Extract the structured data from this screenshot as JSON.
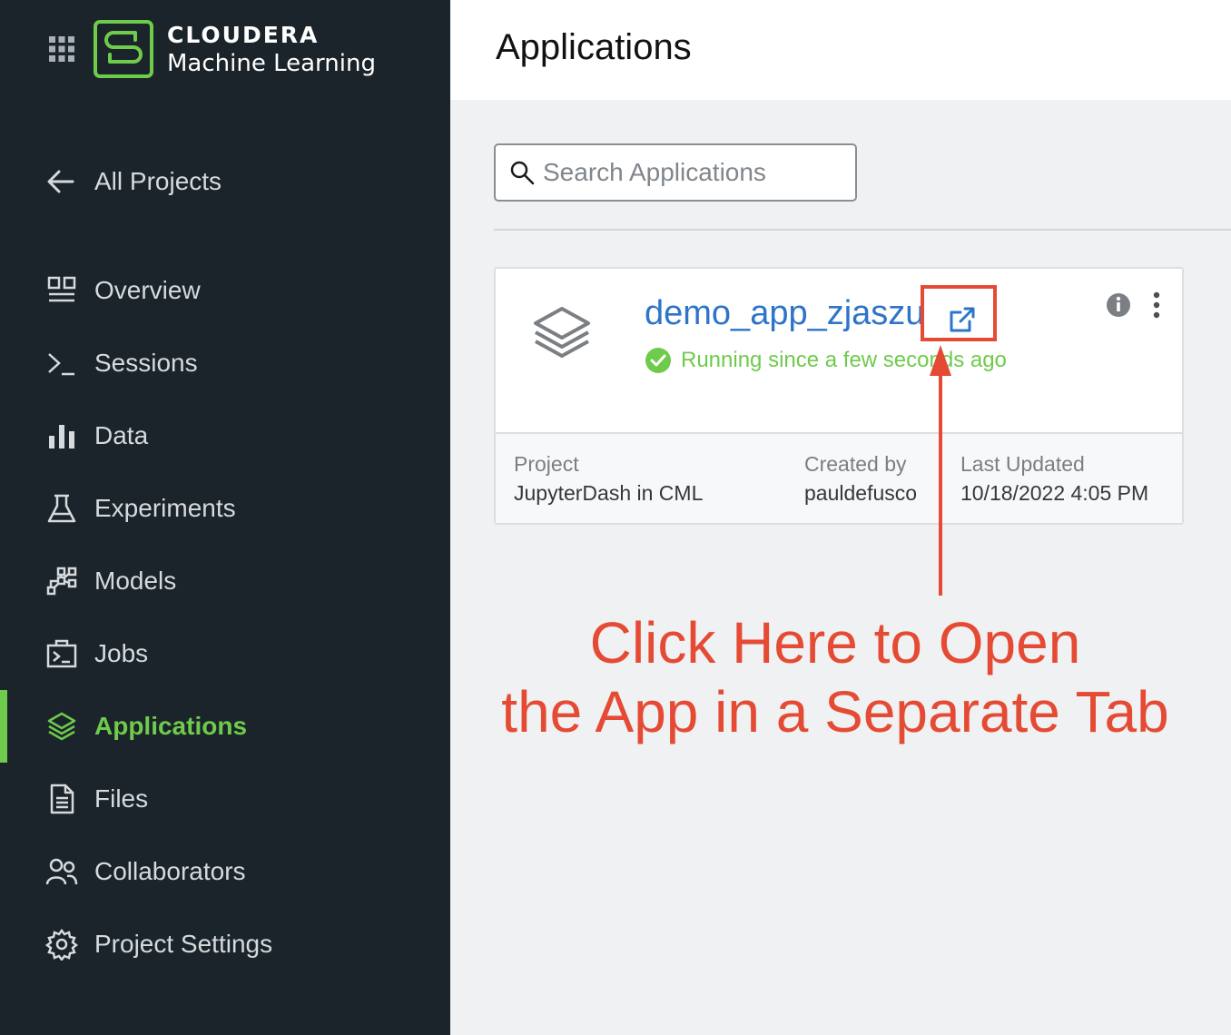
{
  "brand": {
    "name": "CLOUDERA",
    "product": "Machine Learning",
    "accent_color": "#6ecb4b"
  },
  "sidebar": {
    "back_label": "All Projects",
    "items": [
      {
        "label": "Overview",
        "icon": "overview-icon"
      },
      {
        "label": "Sessions",
        "icon": "terminal-icon"
      },
      {
        "label": "Data",
        "icon": "bar-chart-icon"
      },
      {
        "label": "Experiments",
        "icon": "flask-icon"
      },
      {
        "label": "Models",
        "icon": "models-icon"
      },
      {
        "label": "Jobs",
        "icon": "jobs-icon"
      },
      {
        "label": "Applications",
        "icon": "layers-icon",
        "active": true
      },
      {
        "label": "Files",
        "icon": "file-icon"
      },
      {
        "label": "Collaborators",
        "icon": "people-icon"
      },
      {
        "label": "Project Settings",
        "icon": "gear-icon"
      }
    ]
  },
  "header": {
    "title": "Applications"
  },
  "search": {
    "placeholder": "Search Applications"
  },
  "app_card": {
    "name": "demo_app_zjaszu",
    "status": "Running since a few seconds ago",
    "status_color": "#6ecb4b",
    "project_label": "Project",
    "project_value": "JupyterDash in CML",
    "created_by_label": "Created by",
    "created_by_value": "pauldefusco",
    "last_updated_label": "Last Updated",
    "last_updated_value": "10/18/2022 4:05 PM"
  },
  "annotation": {
    "line1": "Click Here to Open",
    "line2": "the App in a Separate Tab",
    "color": "#e54b34"
  }
}
